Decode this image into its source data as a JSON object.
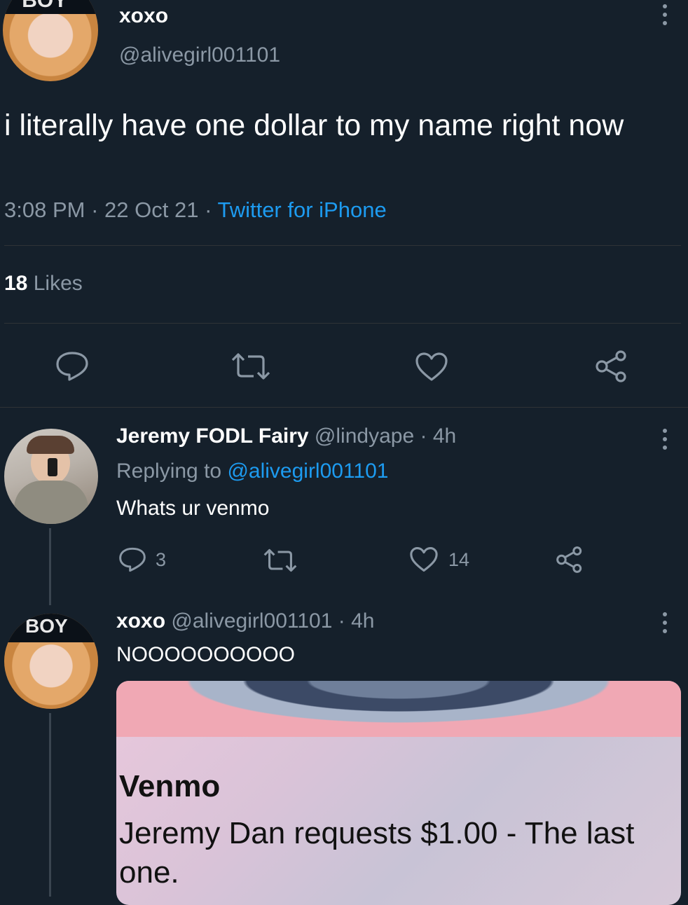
{
  "theme": {
    "background": "#15202b",
    "muted": "#8b98a5",
    "accent": "#1d9bf0",
    "divider": "#2f3336"
  },
  "main_tweet": {
    "avatar_text": "BOY",
    "display_name": "xoxo",
    "handle": "@alivegirl001101",
    "text": "i literally have one dollar to my name right now",
    "time": "3:08 PM",
    "sep1": "·",
    "date": "22 Oct 21",
    "sep2": "·",
    "source": "Twitter for iPhone",
    "likes_count": "18",
    "likes_label": "Likes",
    "actions": [
      "reply-icon",
      "retweet-icon",
      "like-icon",
      "share-icon"
    ]
  },
  "reply1": {
    "display_name": "Jeremy FODL Fairy",
    "handle": "@lindyape",
    "sep": "·",
    "time": "4h",
    "replying_prefix": "Replying to",
    "replying_to": "@alivegirl001101",
    "text": "Whats ur venmo",
    "reply_count": "3",
    "like_count": "14"
  },
  "reply2": {
    "avatar_text": "BOY",
    "display_name": "xoxo",
    "handle": "@alivegirl001101",
    "sep": "·",
    "time": "4h",
    "text": "NOOOOOOOOOO",
    "card": {
      "app": "Venmo",
      "message": "Jeremy Dan requests $1.00 - The last one."
    }
  }
}
